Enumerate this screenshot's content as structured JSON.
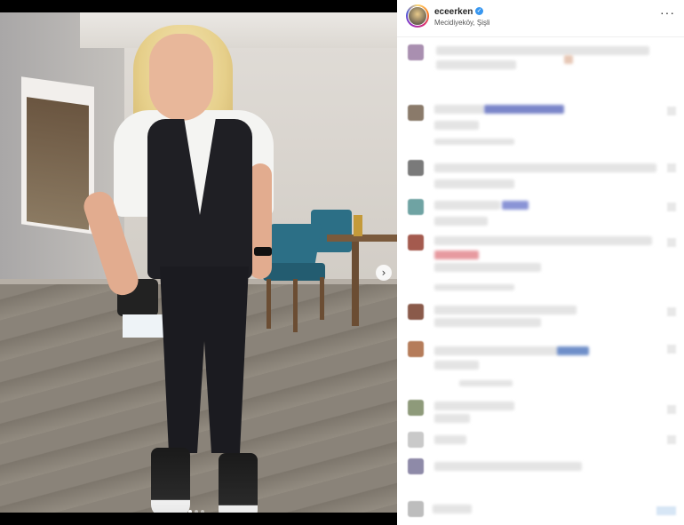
{
  "post": {
    "username": "eceerken",
    "location": "Mecidiyeköy, Şişli",
    "more_label": "···",
    "verified_label": "✓",
    "next_label": "›"
  },
  "colors": {
    "verified": "#3897f0",
    "blur_line": "#e4e4e4",
    "mention_blue": "#7b86c9",
    "pink": "#e79aa0"
  },
  "icons": [
    "verified-badge-icon",
    "more-options-icon",
    "next-arrow-icon"
  ]
}
